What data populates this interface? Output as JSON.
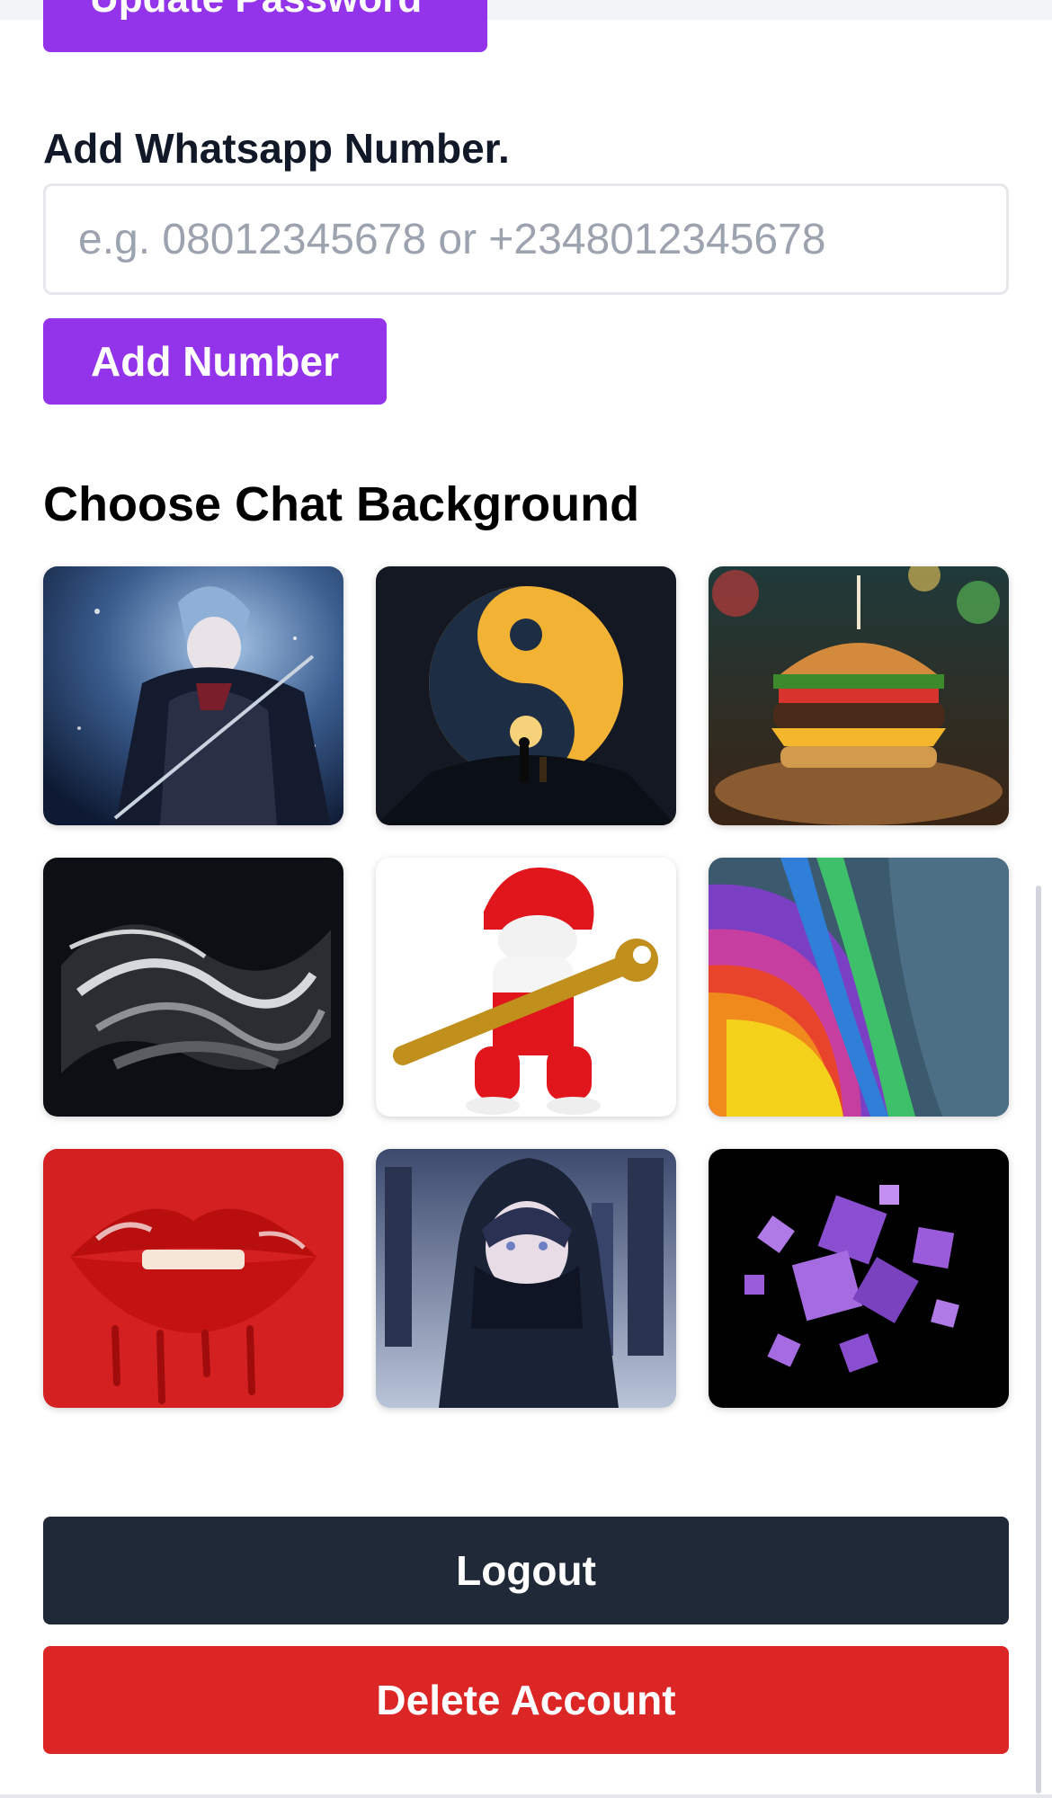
{
  "update_password": {
    "label": "Update Password"
  },
  "whatsapp": {
    "label": "Add Whatsapp Number.",
    "placeholder": "e.g. 08012345678 or +2348012345678",
    "value": "",
    "button_label": "Add Number"
  },
  "backgrounds": {
    "heading": "Choose Chat Background",
    "options": [
      {
        "name": "anime-warrior-snow"
      },
      {
        "name": "yin-yang-moon-landscape"
      },
      {
        "name": "cheeseburger"
      },
      {
        "name": "black-silk-swirl"
      },
      {
        "name": "red-cap-figure-with-wrench"
      },
      {
        "name": "rainbow-waves"
      },
      {
        "name": "dripping-red-lips"
      },
      {
        "name": "hooded-anime-city"
      },
      {
        "name": "purple-cubes"
      }
    ]
  },
  "actions": {
    "logout_label": "Logout",
    "delete_label": "Delete Account"
  },
  "colors": {
    "accent": "#9333ea",
    "logout_bg": "#1f2937",
    "delete_bg": "#dc2626",
    "input_border": "#e5e7eb",
    "placeholder": "#9ca3af"
  }
}
